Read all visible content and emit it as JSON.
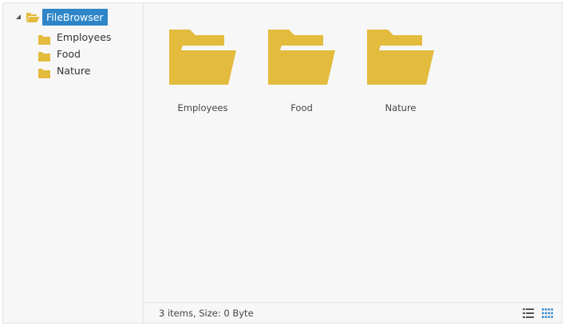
{
  "colors": {
    "folder": "#e3bb3d",
    "selection": "#2e86c8",
    "grid_active": "#2e86c8",
    "icon_muted": "#555555"
  },
  "tree": {
    "root": {
      "label": "FileBrowser",
      "icon": "folder-open-icon",
      "expanded": true,
      "selected": true
    },
    "children": [
      {
        "label": "Employees",
        "icon": "folder-icon"
      },
      {
        "label": "Food",
        "icon": "folder-icon"
      },
      {
        "label": "Nature",
        "icon": "folder-icon"
      }
    ]
  },
  "main": {
    "items": [
      {
        "label": "Employees",
        "icon": "folder-open-icon"
      },
      {
        "label": "Food",
        "icon": "folder-open-icon"
      },
      {
        "label": "Nature",
        "icon": "folder-open-icon"
      }
    ]
  },
  "status": {
    "text": "3 items, Size: 0 Byte",
    "view_modes": [
      "list-view-icon",
      "grid-view-icon"
    ],
    "active_view": "grid"
  }
}
